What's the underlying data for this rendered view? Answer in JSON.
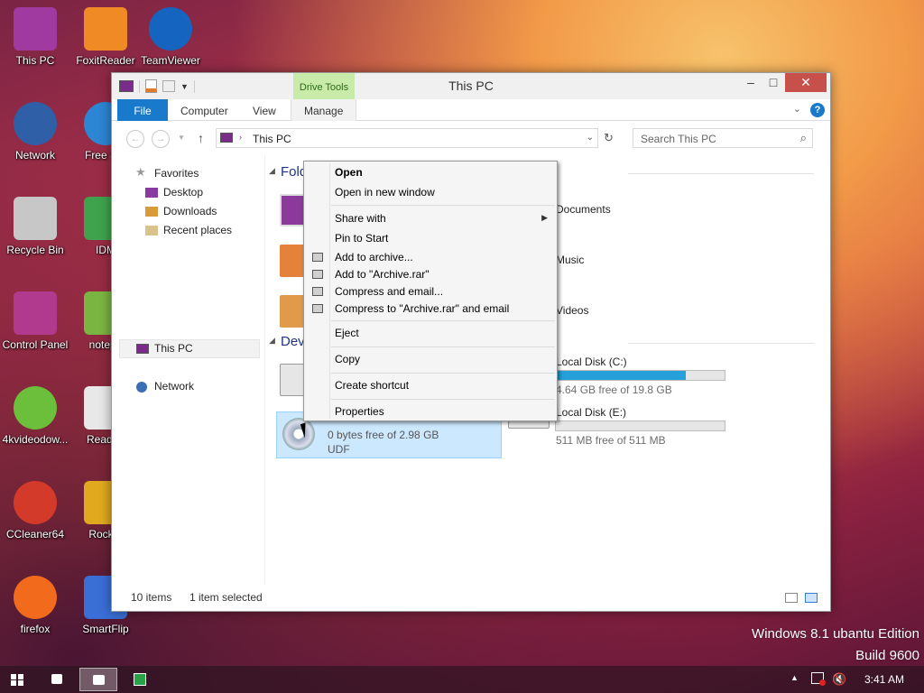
{
  "desktop": {
    "icons": [
      {
        "label": "This PC",
        "icon": "computer-icon",
        "color": "#a03aa0"
      },
      {
        "label": "FoxitReader",
        "icon": "pdf-icon",
        "color": "#f08a24"
      },
      {
        "label": "TeamViewer",
        "icon": "teamviewer-icon",
        "color": "#1565c0"
      },
      {
        "label": "Network",
        "icon": "globe-icon",
        "color": "#2f5fa6"
      },
      {
        "label": "Free Sof",
        "icon": "ie-icon",
        "color": "#2c86d4"
      },
      {
        "label": "Recycle Bin",
        "icon": "recycle-bin-icon",
        "color": "#c7c7c7"
      },
      {
        "label": "IDM",
        "icon": "idm-icon",
        "color": "#3fa34d"
      },
      {
        "label": "Control Panel",
        "icon": "control-panel-icon",
        "color": "#b13a8f"
      },
      {
        "label": "notepa",
        "icon": "notepad-icon",
        "color": "#7ab542"
      },
      {
        "label": "4kvideodow...",
        "icon": "download-icon",
        "color": "#6cbf3a"
      },
      {
        "label": "Read M",
        "icon": "document-icon",
        "color": "#e8e8e8"
      },
      {
        "label": "CCleaner64",
        "icon": "ccleaner-icon",
        "color": "#d43a2a"
      },
      {
        "label": "Rocket",
        "icon": "rocket-icon",
        "color": "#e0a91e"
      },
      {
        "label": "firefox",
        "icon": "firefox-icon",
        "color": "#f26b1d"
      },
      {
        "label": "SmartFlip",
        "icon": "smartflip-icon",
        "color": "#3a6fd6"
      }
    ],
    "watermark_line1": "Windows 8.1 ubantu Edition",
    "watermark_line2": "Build 9600"
  },
  "explorer": {
    "title": "This PC",
    "contextual_tab": "Drive Tools",
    "tabs": {
      "file": "File",
      "computer": "Computer",
      "view": "View",
      "manage": "Manage"
    },
    "address": "This PC",
    "search_placeholder": "Search This PC",
    "nav": {
      "favorites": "Favorites",
      "desktop": "Desktop",
      "downloads": "Downloads",
      "recent": "Recent places",
      "thispc": "This PC",
      "network": "Network"
    },
    "sections": {
      "folders": "Folders",
      "devices": "Devices and drives"
    },
    "folders": {
      "documents": "Documents",
      "music": "Music",
      "videos": "Videos"
    },
    "drives": {
      "c_name": "Local Disk (C:)",
      "c_free": "4.64 GB free of 19.8 GB",
      "c_used_fraction": 0.77,
      "e_name": "Local Disk (E:)",
      "e_free": "511 MB free of 511 MB",
      "e_used_fraction": 0.0,
      "dvd_free": "0 bytes free of 2.98 GB",
      "dvd_fs": "UDF"
    },
    "status": {
      "items": "10 items",
      "selected": "1 item selected"
    }
  },
  "context_menu": {
    "open": "Open",
    "open_new": "Open in new window",
    "share": "Share with",
    "pin": "Pin to Start",
    "add_archive": "Add to archive...",
    "add_rar": "Add to \"Archive.rar\"",
    "compress_email": "Compress and email...",
    "compress_rar_email": "Compress to \"Archive.rar\" and email",
    "eject": "Eject",
    "copy": "Copy",
    "shortcut": "Create shortcut",
    "properties": "Properties"
  },
  "taskbar": {
    "time": "3:41 AM"
  },
  "colors": {
    "accent": "#1979ca",
    "selection": "#cce8ff",
    "close": "#c7504b",
    "drive_bar": "#26a0da"
  }
}
